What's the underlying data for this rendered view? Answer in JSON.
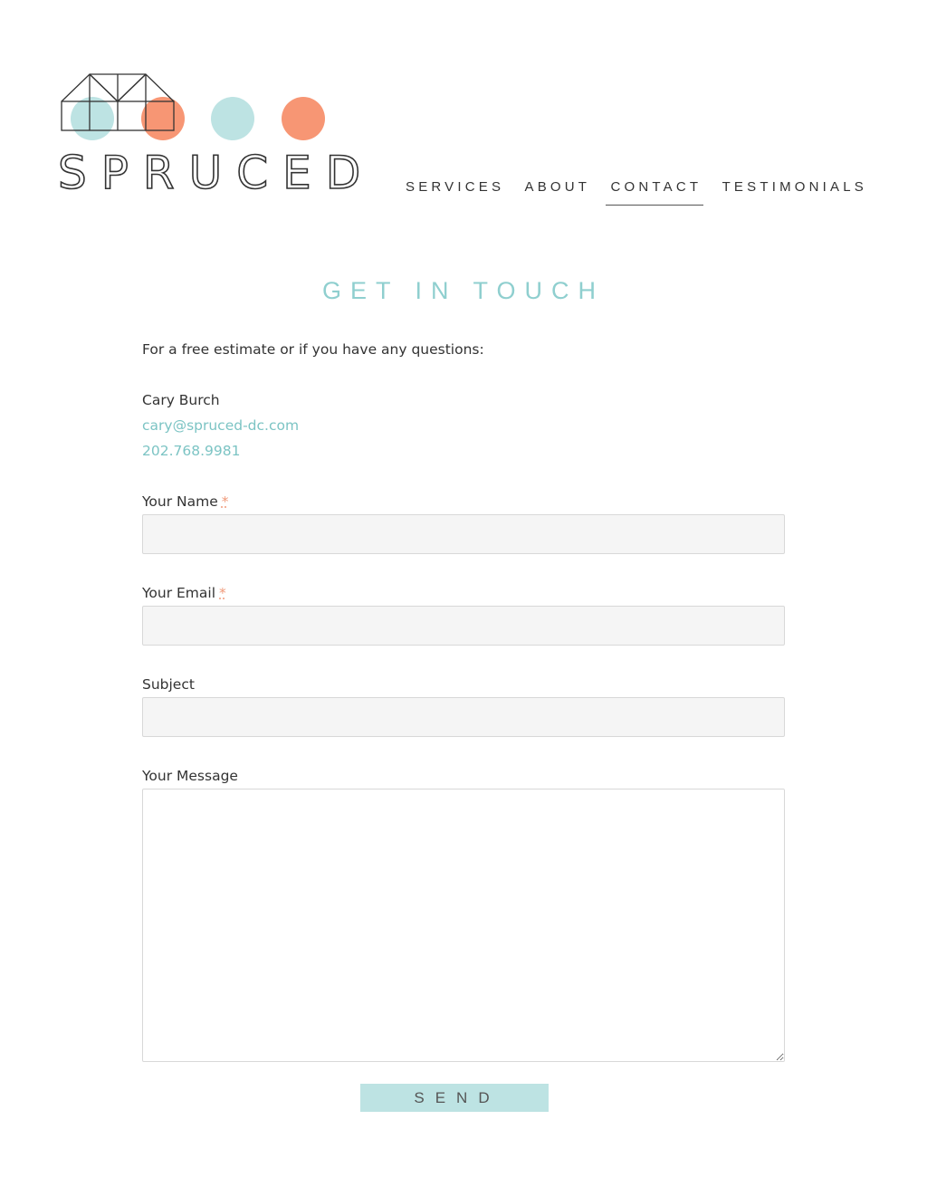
{
  "brand": {
    "name": "SPRUCED",
    "teal": "#bde3e3",
    "coral": "#f79674",
    "accent_text": "#7cc4c4"
  },
  "nav": {
    "items": [
      {
        "label": "SERVICES",
        "active": false
      },
      {
        "label": "ABOUT",
        "active": false
      },
      {
        "label": "CONTACT",
        "active": true
      },
      {
        "label": "TESTIMONIALS",
        "active": false
      }
    ]
  },
  "page": {
    "title": "GET IN TOUCH",
    "intro": "For a free estimate or if you have any questions:"
  },
  "contact": {
    "name": "Cary Burch",
    "email": "cary@spruced-dc.com",
    "phone": "202.768.9981"
  },
  "form": {
    "name_label": "Your Name",
    "email_label": "Your Email",
    "subject_label": "Subject",
    "message_label": "Your Message",
    "required_mark": "*",
    "name_value": "",
    "email_value": "",
    "subject_value": "",
    "message_value": "",
    "send_label": "SEND"
  }
}
